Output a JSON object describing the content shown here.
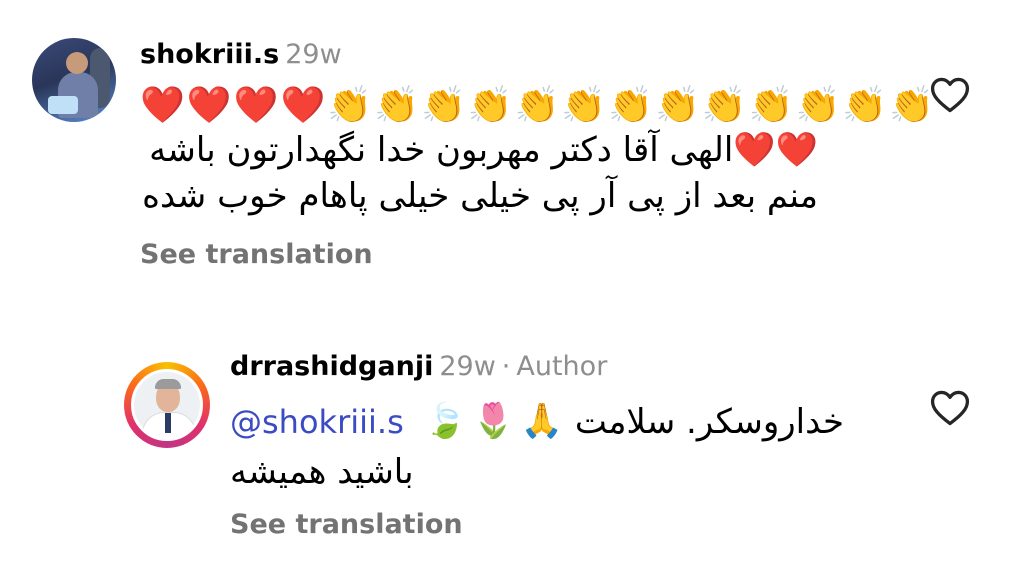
{
  "comments": [
    {
      "username": "shokriii.s",
      "time": "29w",
      "emoji_line": "❤️❤️❤️❤️👏👏👏👏👏👏👏👏👏👏👏👏👏",
      "text_line1": "❤️❤️الهی آقا دکتر مهربون خدا نگهدارتون باشه",
      "text_line2": "منم بعد از پی آر پی خیلی خیلی پاهام خوب شده",
      "see_translation": "See translation",
      "like_icon": "heart-outline-icon"
    },
    {
      "username": "drrashidganji",
      "time": "29w",
      "separator": "·",
      "badge": "Author",
      "mention": "@shokriii.s",
      "mention_emoji": "🍃🌷🙏",
      "text_line1": "خداروسکر. سلامت",
      "text_line2": "باشید همیشه",
      "see_translation": "See translation",
      "like_icon": "heart-outline-icon"
    }
  ],
  "colors": {
    "primary_text": "#000000",
    "secondary_text": "#8e8e8e",
    "see_translation": "#737373",
    "mention": "#3b4bc3",
    "story_ring": [
      "#f9c000",
      "#fb6a1a",
      "#e1306c",
      "#c13584"
    ]
  }
}
